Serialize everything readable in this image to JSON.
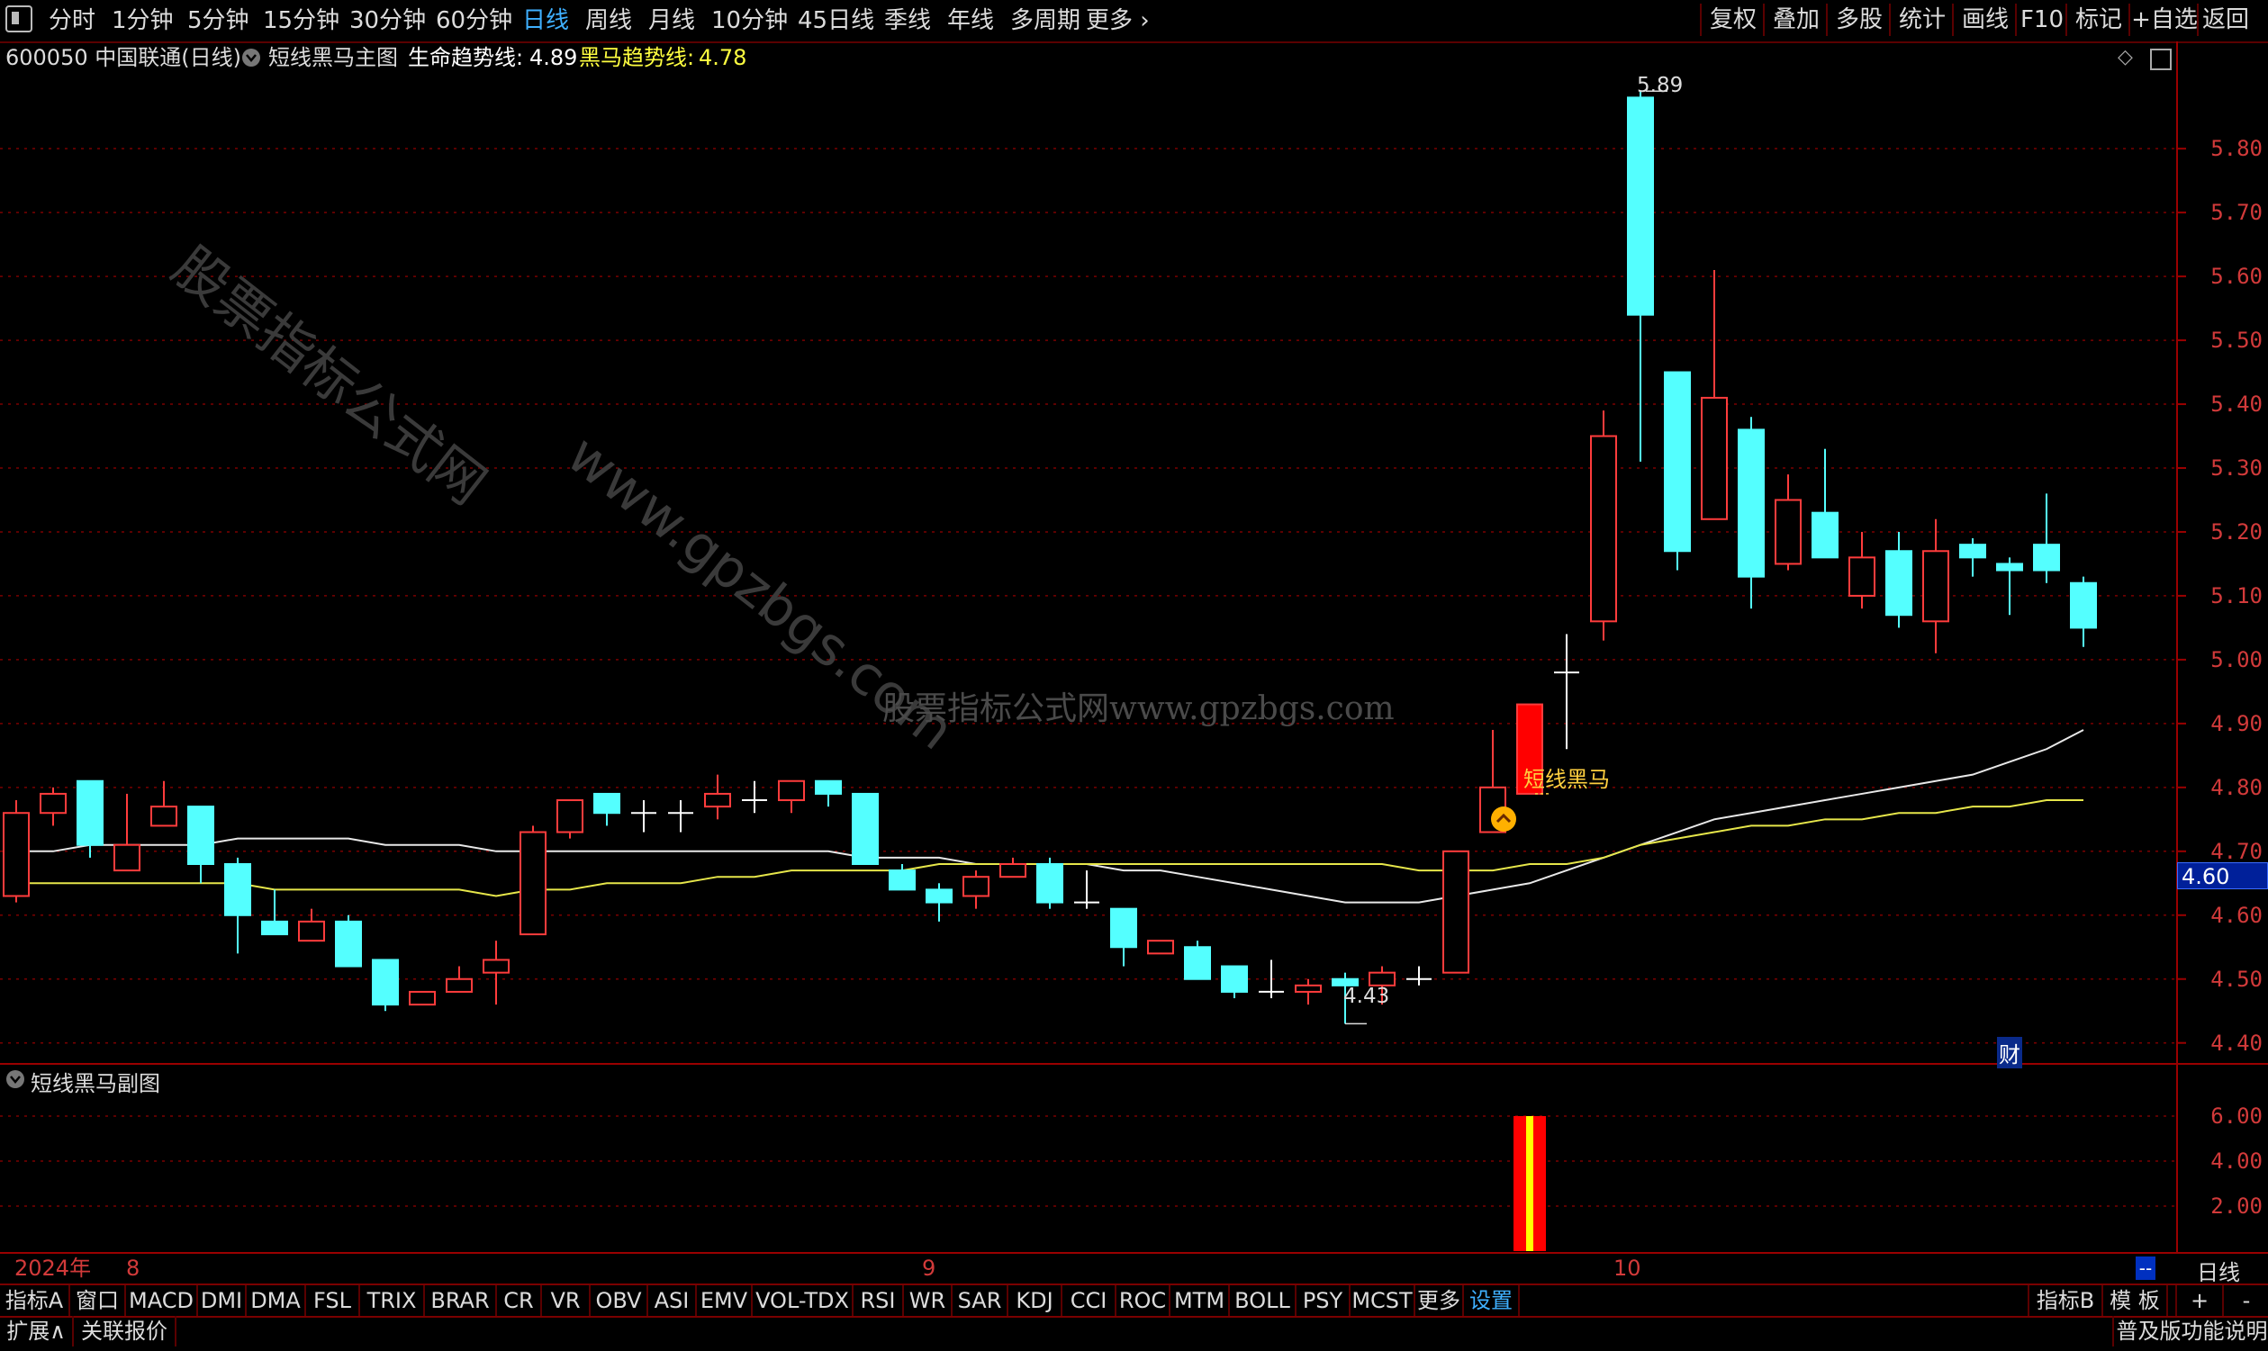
{
  "toolbar": {
    "left_icon": "window-icon",
    "periods": [
      "分时",
      "1分钟",
      "5分钟",
      "15分钟",
      "30分钟",
      "60分钟",
      "日线",
      "周线",
      "月线",
      "10分钟",
      "45日线",
      "季线",
      "年线",
      "多周期",
      "更多"
    ],
    "active_period": "日线",
    "right_buttons": [
      "复权",
      "叠加",
      "多股",
      "统计",
      "画线",
      "F10",
      "标记",
      "+自选",
      "返回"
    ]
  },
  "header": {
    "stock": "600050 中国联通(日线)",
    "indicator": "短线黑马主图",
    "life_line_label": "生命趋势线:",
    "life_line_value": "4.89",
    "horse_line_label": "黑马趋势线:",
    "horse_line_value": "4.78"
  },
  "watermark": {
    "diag1": "股票指标公式网",
    "diag2": "www.gpzbgs.com",
    "center": "股票指标公式网www.gpzbgs.com"
  },
  "annotations": {
    "high_label": "5.89",
    "low_label": "4.43",
    "signal_label": "短线黑马",
    "current_price": "4.60",
    "cai_badge": "财"
  },
  "sub_panel": {
    "title": "短线黑马副图",
    "y_ticks": [
      "6.00",
      "4.00",
      "2.00"
    ]
  },
  "date_axis": {
    "year": "2024年",
    "months": [
      "8",
      "9",
      "10"
    ],
    "right_scroll": "--",
    "period_label": "日线"
  },
  "indicator_tabs": [
    "指标A",
    "窗口",
    "MACD",
    "DMI",
    "DMA",
    "FSL",
    "TRIX",
    "BRAR",
    "CR",
    "VR",
    "OBV",
    "ASI",
    "EMV",
    "VOL-TDX",
    "RSI",
    "WR",
    "SAR",
    "KDJ",
    "CCI",
    "ROC",
    "MTM",
    "BOLL",
    "PSY",
    "MCST",
    "更多",
    "设置"
  ],
  "active_tab": "设置",
  "indicator_right": [
    "指标B",
    "模 板",
    "+",
    "-"
  ],
  "status_bar": {
    "expand": "扩展∧",
    "quote": "关联报价",
    "help": "普及版功能说明"
  },
  "colors": {
    "up": "#ff3c3c",
    "down": "#54ffff",
    "life_line": "#e8e8e8",
    "horse_line": "#e6e64a",
    "grid": "#7a0000"
  },
  "chart_data": {
    "type": "candlestick",
    "y_ticks": [
      5.8,
      5.7,
      5.6,
      5.5,
      5.4,
      5.3,
      5.2,
      5.1,
      5.0,
      4.9,
      4.8,
      4.7,
      4.6,
      4.5,
      4.4
    ],
    "ylim": [
      4.37,
      5.92
    ],
    "candles": [
      {
        "o": 4.63,
        "h": 4.78,
        "l": 4.62,
        "c": 4.76
      },
      {
        "o": 4.76,
        "h": 4.8,
        "l": 4.74,
        "c": 4.79
      },
      {
        "o": 4.81,
        "h": 4.81,
        "l": 4.69,
        "c": 4.71
      },
      {
        "o": 4.67,
        "h": 4.79,
        "l": 4.67,
        "c": 4.71
      },
      {
        "o": 4.74,
        "h": 4.81,
        "l": 4.74,
        "c": 4.77
      },
      {
        "o": 4.77,
        "h": 4.77,
        "l": 4.65,
        "c": 4.68
      },
      {
        "o": 4.68,
        "h": 4.69,
        "l": 4.54,
        "c": 4.6
      },
      {
        "o": 4.59,
        "h": 4.64,
        "l": 4.57,
        "c": 4.57
      },
      {
        "o": 4.56,
        "h": 4.61,
        "l": 4.56,
        "c": 4.59
      },
      {
        "o": 4.59,
        "h": 4.6,
        "l": 4.52,
        "c": 4.52
      },
      {
        "o": 4.53,
        "h": 4.53,
        "l": 4.45,
        "c": 4.46
      },
      {
        "o": 4.46,
        "h": 4.48,
        "l": 4.46,
        "c": 4.48
      },
      {
        "o": 4.48,
        "h": 4.52,
        "l": 4.48,
        "c": 4.5
      },
      {
        "o": 4.51,
        "h": 4.56,
        "l": 4.46,
        "c": 4.53
      },
      {
        "o": 4.57,
        "h": 4.74,
        "l": 4.57,
        "c": 4.73
      },
      {
        "o": 4.73,
        "h": 4.78,
        "l": 4.72,
        "c": 4.78
      },
      {
        "o": 4.79,
        "h": 4.79,
        "l": 4.74,
        "c": 4.76
      },
      {
        "o": 4.76,
        "h": 4.78,
        "l": 4.73,
        "c": 4.76
      },
      {
        "o": 4.76,
        "h": 4.78,
        "l": 4.73,
        "c": 4.76
      },
      {
        "o": 4.77,
        "h": 4.82,
        "l": 4.75,
        "c": 4.79
      },
      {
        "o": 4.78,
        "h": 4.81,
        "l": 4.76,
        "c": 4.78
      },
      {
        "o": 4.78,
        "h": 4.81,
        "l": 4.76,
        "c": 4.81
      },
      {
        "o": 4.81,
        "h": 4.81,
        "l": 4.77,
        "c": 4.79
      },
      {
        "o": 4.79,
        "h": 4.79,
        "l": 4.68,
        "c": 4.68
      },
      {
        "o": 4.67,
        "h": 4.68,
        "l": 4.64,
        "c": 4.64
      },
      {
        "o": 4.64,
        "h": 4.65,
        "l": 4.59,
        "c": 4.62
      },
      {
        "o": 4.63,
        "h": 4.67,
        "l": 4.61,
        "c": 4.66
      },
      {
        "o": 4.66,
        "h": 4.69,
        "l": 4.66,
        "c": 4.68
      },
      {
        "o": 4.68,
        "h": 4.69,
        "l": 4.61,
        "c": 4.62
      },
      {
        "o": 4.62,
        "h": 4.67,
        "l": 4.61,
        "c": 4.62
      },
      {
        "o": 4.61,
        "h": 4.61,
        "l": 4.52,
        "c": 4.55
      },
      {
        "o": 4.54,
        "h": 4.56,
        "l": 4.54,
        "c": 4.56
      },
      {
        "o": 4.55,
        "h": 4.56,
        "l": 4.5,
        "c": 4.5
      },
      {
        "o": 4.52,
        "h": 4.52,
        "l": 4.47,
        "c": 4.48
      },
      {
        "o": 4.48,
        "h": 4.53,
        "l": 4.47,
        "c": 4.48
      },
      {
        "o": 4.48,
        "h": 4.5,
        "l": 4.46,
        "c": 4.49
      },
      {
        "o": 4.5,
        "h": 4.51,
        "l": 4.43,
        "c": 4.49
      },
      {
        "o": 4.49,
        "h": 4.52,
        "l": 4.46,
        "c": 4.51
      },
      {
        "o": 4.5,
        "h": 4.52,
        "l": 4.49,
        "c": 4.5
      },
      {
        "o": 4.51,
        "h": 4.7,
        "l": 4.51,
        "c": 4.7
      },
      {
        "o": 4.73,
        "h": 4.89,
        "l": 4.73,
        "c": 4.8
      },
      {
        "o": 4.79,
        "h": 4.93,
        "l": 4.79,
        "c": 4.93
      },
      {
        "o": 4.98,
        "h": 5.04,
        "l": 4.86,
        "c": 4.98
      },
      {
        "o": 5.06,
        "h": 5.39,
        "l": 5.03,
        "c": 5.35
      },
      {
        "o": 5.88,
        "h": 5.89,
        "l": 5.31,
        "c": 5.54
      },
      {
        "o": 5.45,
        "h": 5.45,
        "l": 5.14,
        "c": 5.17
      },
      {
        "o": 5.22,
        "h": 5.61,
        "l": 5.22,
        "c": 5.41
      },
      {
        "o": 5.36,
        "h": 5.38,
        "l": 5.08,
        "c": 5.13
      },
      {
        "o": 5.15,
        "h": 5.29,
        "l": 5.14,
        "c": 5.25
      },
      {
        "o": 5.23,
        "h": 5.33,
        "l": 5.16,
        "c": 5.16
      },
      {
        "o": 5.1,
        "h": 5.2,
        "l": 5.08,
        "c": 5.16
      },
      {
        "o": 5.17,
        "h": 5.2,
        "l": 5.05,
        "c": 5.07
      },
      {
        "o": 5.06,
        "h": 5.22,
        "l": 5.01,
        "c": 5.17
      },
      {
        "o": 5.18,
        "h": 5.19,
        "l": 5.13,
        "c": 5.16
      },
      {
        "o": 5.15,
        "h": 5.16,
        "l": 5.07,
        "c": 5.14
      },
      {
        "o": 5.18,
        "h": 5.26,
        "l": 5.12,
        "c": 5.14
      },
      {
        "o": 5.12,
        "h": 5.13,
        "l": 5.02,
        "c": 5.05
      }
    ],
    "life_trend_line": [
      4.7,
      4.7,
      4.71,
      4.71,
      4.71,
      4.71,
      4.72,
      4.72,
      4.72,
      4.72,
      4.71,
      4.71,
      4.71,
      4.7,
      4.7,
      4.7,
      4.7,
      4.7,
      4.7,
      4.7,
      4.7,
      4.7,
      4.7,
      4.69,
      4.69,
      4.69,
      4.68,
      4.68,
      4.68,
      4.68,
      4.67,
      4.67,
      4.66,
      4.65,
      4.64,
      4.63,
      4.62,
      4.62,
      4.62,
      4.63,
      4.64,
      4.65,
      4.67,
      4.69,
      4.71,
      4.73,
      4.75,
      4.76,
      4.77,
      4.78,
      4.79,
      4.8,
      4.81,
      4.82,
      4.84,
      4.86,
      4.89
    ],
    "horse_trend_line": [
      4.65,
      4.65,
      4.65,
      4.65,
      4.65,
      4.65,
      4.65,
      4.64,
      4.64,
      4.64,
      4.64,
      4.64,
      4.64,
      4.63,
      4.64,
      4.64,
      4.65,
      4.65,
      4.65,
      4.66,
      4.66,
      4.67,
      4.67,
      4.67,
      4.67,
      4.68,
      4.68,
      4.68,
      4.68,
      4.68,
      4.68,
      4.68,
      4.68,
      4.68,
      4.68,
      4.68,
      4.68,
      4.68,
      4.67,
      4.67,
      4.67,
      4.68,
      4.68,
      4.69,
      4.71,
      4.72,
      4.73,
      4.74,
      4.74,
      4.75,
      4.75,
      4.76,
      4.76,
      4.77,
      4.77,
      4.78,
      4.78
    ],
    "sub_bars": [
      {
        "index": 41,
        "value": 6.0
      }
    ],
    "sub_ylim": [
      0,
      7
    ]
  }
}
